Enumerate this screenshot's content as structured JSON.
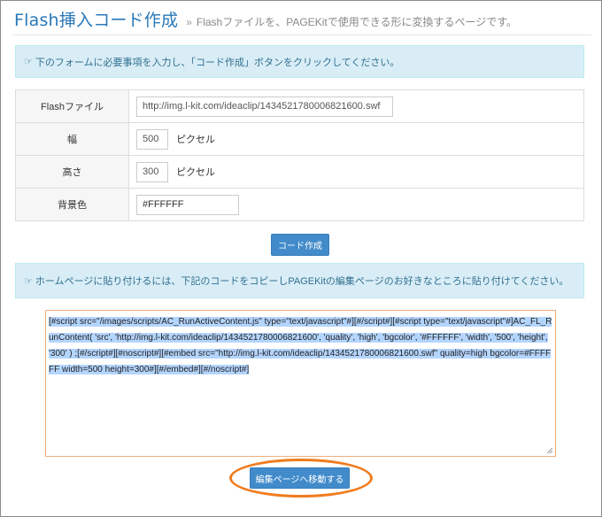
{
  "header": {
    "title": "Flash挿入コード作成",
    "separator": "»",
    "subtitle": "Flashファイルを、PAGEKitで使用できる形に変換するページです。"
  },
  "notices": {
    "form_hint": "下のフォームに必要事項を入力し、「コード作成」ボタンをクリックしてください。",
    "paste_hint": "ホームページに貼り付けるには、下記のコードをコピーしPAGEKitの編集ページのお好きなところに貼り付けてください。",
    "icon": "pointing-hand-icon"
  },
  "form": {
    "flash_file": {
      "label": "Flashファイル",
      "value": "http://img.l-kit.com/ideaclip/1434521780006821600.swf"
    },
    "width": {
      "label": "幅",
      "value": "500",
      "unit": "ピクセル"
    },
    "height": {
      "label": "高さ",
      "value": "300",
      "unit": "ピクセル"
    },
    "bgcolor": {
      "label": "背景色",
      "value": "#FFFFFF"
    }
  },
  "buttons": {
    "create": "コード作成",
    "go_edit": "編集ページへ移動する"
  },
  "code_output": "[#script src=\"/images/scripts/AC_RunActiveContent.js\" type=\"text/javascript\"#][#/script#][#script type=\"text/javascript\"#]AC_FL_RunContent( 'src', 'http://img.l-kit.com/ideaclip/1434521780006821600', 'quality', 'high', 'bgcolor', '#FFFFFF', 'width', '500', 'height', '300' ) ;[#/script#][#noscript#][#embed src=\"http://img.l-kit.com/ideaclip/1434521780006821600.swf\" quality=high bgcolor=#FFFFFF width=500 height=300#][#/embed#][#/noscript#]",
  "colors": {
    "title": "#2a78b8",
    "notice_bg": "#d9edf7",
    "button": "#428bca",
    "selection": "#b4d5fe",
    "highlight_ring": "#f07c1f"
  }
}
